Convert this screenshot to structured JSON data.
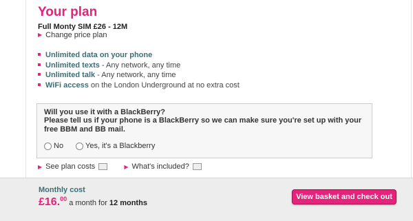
{
  "plan": {
    "title": "Your plan",
    "plan_name": "Full Monty SIM £26 - 12M",
    "change_link": "Change price plan"
  },
  "features": [
    {
      "name": "Unlimited data on your phone",
      "detail": ""
    },
    {
      "name": "Unlimited texts",
      "detail": " - Any network, any time"
    },
    {
      "name": "Unlimited talk",
      "detail": " - Any network, any time"
    },
    {
      "name": "WiFi access",
      "detail": " on the London Underground at no extra cost"
    }
  ],
  "blackberry": {
    "question": "Will you use it with a BlackBerry?",
    "prompt": "Please tell us if your phone is a BlackBerry so we can make sure you're set up with your free BBM and BB mail.",
    "option_no": "No",
    "option_yes": "Yes, it's a Blackberry",
    "selected": null
  },
  "links": {
    "plan_costs": "See plan costs",
    "included": "What's included?"
  },
  "footer": {
    "monthly_label": "Monthly cost",
    "price_pounds": "£16.",
    "price_pence": "00",
    "per_month": " a month for ",
    "term": "12 months",
    "checkout_label": "View basket and check out"
  },
  "colors": {
    "accent": "#e5237a",
    "feature_text": "#3b6e74"
  },
  "icons": {
    "link_arrow": "arrow-right-icon",
    "info": "info-box-icon",
    "bullet": "square-bullet-icon"
  }
}
